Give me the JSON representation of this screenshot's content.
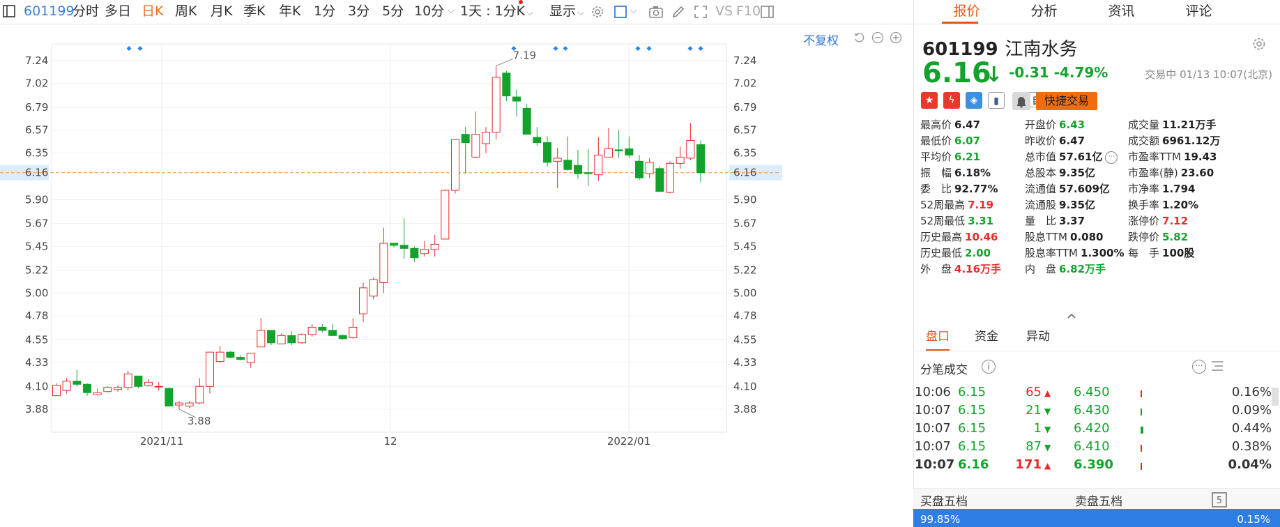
{
  "stock": {
    "code": "601199",
    "name": "江南水务",
    "price": "6.16",
    "change": "-0.31",
    "change_pct": "-4.79%",
    "trade_status": "交易中 01/13 10:07(北京)",
    "down_color": "#13a32c",
    "up_color": "#e8292a"
  },
  "toolbar": {
    "code": "601199",
    "items": [
      "分时",
      "多日",
      "日K",
      "周K",
      "月K",
      "季K",
      "年K",
      "1分",
      "3分",
      "5分",
      "10分"
    ],
    "active": "日K",
    "range": "1天 : 1分K",
    "display": "显示",
    "vs": "VS",
    "f10": "F10",
    "accent_color": "#f26b1d"
  },
  "chart": {
    "fq_label": "不复权",
    "ref_price": "6.16",
    "high_label": "7.19",
    "low_label": "3.88"
  },
  "chart_data": {
    "type": "candlestick",
    "y_ticks": [
      "7.24",
      "7.02",
      "6.79",
      "6.57",
      "6.35",
      "6.16",
      "5.90",
      "5.67",
      "5.45",
      "5.22",
      "5.00",
      "4.78",
      "4.55",
      "4.33",
      "4.10",
      "3.88"
    ],
    "x_ticks": [
      "2021/11",
      "12",
      "2022/01"
    ],
    "ylim": [
      3.88,
      7.24
    ],
    "candles": [
      {
        "o": 4.01,
        "h": 4.13,
        "l": 4.01,
        "c": 4.11
      },
      {
        "o": 4.06,
        "h": 4.18,
        "l": 4.03,
        "c": 4.15
      },
      {
        "o": 4.15,
        "h": 4.26,
        "l": 4.1,
        "c": 4.12
      },
      {
        "o": 4.12,
        "h": 4.13,
        "l": 4.01,
        "c": 4.04
      },
      {
        "o": 4.02,
        "h": 4.08,
        "l": 4.01,
        "c": 4.04
      },
      {
        "o": 4.05,
        "h": 4.1,
        "l": 4.04,
        "c": 4.09
      },
      {
        "o": 4.07,
        "h": 4.11,
        "l": 4.05,
        "c": 4.09
      },
      {
        "o": 4.09,
        "h": 4.25,
        "l": 4.06,
        "c": 4.22
      },
      {
        "o": 4.2,
        "h": 4.2,
        "l": 4.08,
        "c": 4.1
      },
      {
        "o": 4.11,
        "h": 4.17,
        "l": 4.1,
        "c": 4.14
      },
      {
        "o": 4.1,
        "h": 4.14,
        "l": 4.06,
        "c": 4.1
      },
      {
        "o": 4.08,
        "h": 4.09,
        "l": 3.91,
        "c": 3.91
      },
      {
        "o": 3.92,
        "h": 3.96,
        "l": 3.88,
        "c": 3.94
      },
      {
        "o": 3.91,
        "h": 3.96,
        "l": 3.89,
        "c": 3.94
      },
      {
        "o": 3.94,
        "h": 4.18,
        "l": 3.93,
        "c": 4.1
      },
      {
        "o": 4.1,
        "h": 4.43,
        "l": 4.03,
        "c": 4.43
      },
      {
        "o": 4.34,
        "h": 4.49,
        "l": 4.33,
        "c": 4.43
      },
      {
        "o": 4.43,
        "h": 4.44,
        "l": 4.37,
        "c": 4.38
      },
      {
        "o": 4.38,
        "h": 4.4,
        "l": 4.35,
        "c": 4.36
      },
      {
        "o": 4.33,
        "h": 4.42,
        "l": 4.28,
        "c": 4.42
      },
      {
        "o": 4.48,
        "h": 4.76,
        "l": 4.48,
        "c": 4.64
      },
      {
        "o": 4.64,
        "h": 4.64,
        "l": 4.5,
        "c": 4.52
      },
      {
        "o": 4.51,
        "h": 4.61,
        "l": 4.51,
        "c": 4.59
      },
      {
        "o": 4.59,
        "h": 4.63,
        "l": 4.5,
        "c": 4.52
      },
      {
        "o": 4.52,
        "h": 4.61,
        "l": 4.51,
        "c": 4.6
      },
      {
        "o": 4.6,
        "h": 4.7,
        "l": 4.58,
        "c": 4.67
      },
      {
        "o": 4.67,
        "h": 4.7,
        "l": 4.62,
        "c": 4.64
      },
      {
        "o": 4.64,
        "h": 4.7,
        "l": 4.6,
        "c": 4.59
      },
      {
        "o": 4.59,
        "h": 4.6,
        "l": 4.55,
        "c": 4.56
      },
      {
        "o": 4.57,
        "h": 4.76,
        "l": 4.56,
        "c": 4.67
      },
      {
        "o": 4.8,
        "h": 5.1,
        "l": 4.72,
        "c": 5.05
      },
      {
        "o": 4.97,
        "h": 5.15,
        "l": 4.94,
        "c": 5.13
      },
      {
        "o": 5.1,
        "h": 5.63,
        "l": 5.0,
        "c": 5.48
      },
      {
        "o": 5.48,
        "h": 5.48,
        "l": 5.44,
        "c": 5.46
      },
      {
        "o": 5.46,
        "h": 5.72,
        "l": 5.33,
        "c": 5.43
      },
      {
        "o": 5.43,
        "h": 5.45,
        "l": 5.3,
        "c": 5.34
      },
      {
        "o": 5.38,
        "h": 5.5,
        "l": 5.35,
        "c": 5.42
      },
      {
        "o": 5.42,
        "h": 5.56,
        "l": 5.35,
        "c": 5.47
      },
      {
        "o": 5.52,
        "h": 6.0,
        "l": 5.52,
        "c": 5.99
      },
      {
        "o": 5.99,
        "h": 6.48,
        "l": 5.96,
        "c": 6.48
      },
      {
        "o": 6.53,
        "h": 6.6,
        "l": 6.15,
        "c": 6.45
      },
      {
        "o": 6.31,
        "h": 6.75,
        "l": 6.3,
        "c": 6.53
      },
      {
        "o": 6.44,
        "h": 6.6,
        "l": 6.35,
        "c": 6.55
      },
      {
        "o": 6.55,
        "h": 7.19,
        "l": 6.48,
        "c": 7.08
      },
      {
        "o": 7.12,
        "h": 7.14,
        "l": 6.85,
        "c": 6.9
      },
      {
        "o": 6.89,
        "h": 6.96,
        "l": 6.7,
        "c": 6.85
      },
      {
        "o": 6.78,
        "h": 6.82,
        "l": 6.53,
        "c": 6.53
      },
      {
        "o": 6.5,
        "h": 6.6,
        "l": 6.42,
        "c": 6.45
      },
      {
        "o": 6.45,
        "h": 6.51,
        "l": 6.22,
        "c": 6.26
      },
      {
        "o": 6.27,
        "h": 6.4,
        "l": 6.01,
        "c": 6.3
      },
      {
        "o": 6.28,
        "h": 6.51,
        "l": 6.18,
        "c": 6.19
      },
      {
        "o": 6.23,
        "h": 6.38,
        "l": 6.1,
        "c": 6.15
      },
      {
        "o": 6.16,
        "h": 6.39,
        "l": 6.03,
        "c": 6.15
      },
      {
        "o": 6.14,
        "h": 6.5,
        "l": 6.08,
        "c": 6.33
      },
      {
        "o": 6.31,
        "h": 6.59,
        "l": 6.31,
        "c": 6.39
      },
      {
        "o": 6.38,
        "h": 6.57,
        "l": 6.3,
        "c": 6.37
      },
      {
        "o": 6.39,
        "h": 6.51,
        "l": 6.3,
        "c": 6.33
      },
      {
        "o": 6.27,
        "h": 6.33,
        "l": 6.09,
        "c": 6.11
      },
      {
        "o": 6.15,
        "h": 6.3,
        "l": 6.11,
        "c": 6.26
      },
      {
        "o": 6.2,
        "h": 6.22,
        "l": 5.98,
        "c": 5.98
      },
      {
        "o": 5.97,
        "h": 6.27,
        "l": 5.96,
        "c": 6.25
      },
      {
        "o": 6.25,
        "h": 6.41,
        "l": 6.2,
        "c": 6.31
      },
      {
        "o": 6.3,
        "h": 6.64,
        "l": 6.28,
        "c": 6.47
      },
      {
        "o": 6.43,
        "h": 6.47,
        "l": 6.07,
        "c": 6.16
      }
    ],
    "marker_x": [
      185,
      201,
      737,
      797,
      811,
      915,
      931,
      990,
      1005
    ]
  },
  "panel": {
    "tabs": [
      "报价",
      "分析",
      "资讯",
      "评论"
    ],
    "active_tab": "报价",
    "fav_label": "自选",
    "quick_trade": "快捷交易",
    "stats": [
      [
        {
          "k": "最高价",
          "v": "6.47",
          "c": "black"
        },
        {
          "k": "开盘价",
          "v": "6.43",
          "c": "green"
        },
        {
          "k": "成交量",
          "v": "11.21万手",
          "c": "black"
        }
      ],
      [
        {
          "k": "最低价",
          "v": "6.07",
          "c": "green"
        },
        {
          "k": "昨收价",
          "v": "6.47",
          "c": "black"
        },
        {
          "k": "成交额",
          "v": "6961.12万",
          "c": "black"
        }
      ],
      [
        {
          "k": "平均价",
          "v": "6.21",
          "c": "green"
        },
        {
          "k": "总市值",
          "v": "57.61亿",
          "c": "black"
        },
        {
          "k": "市盈率TTM",
          "v": "19.43",
          "c": "black"
        }
      ],
      [
        {
          "k": "振　幅",
          "v": "6.18%",
          "c": "black"
        },
        {
          "k": "总股本",
          "v": "9.35亿",
          "c": "black"
        },
        {
          "k": "市盈率(静)",
          "v": "23.60",
          "c": "black"
        }
      ],
      [
        {
          "k": "委　比",
          "v": "92.77%",
          "c": "black"
        },
        {
          "k": "流通值",
          "v": "57.609亿",
          "c": "black"
        },
        {
          "k": "市净率",
          "v": "1.794",
          "c": "black"
        }
      ],
      [
        {
          "k": "52周最高",
          "v": "7.19",
          "c": "red"
        },
        {
          "k": "流通股",
          "v": "9.35亿",
          "c": "black"
        },
        {
          "k": "换手率",
          "v": "1.20%",
          "c": "black"
        }
      ],
      [
        {
          "k": "52周最低",
          "v": "3.31",
          "c": "green"
        },
        {
          "k": "量　比",
          "v": "3.37",
          "c": "black"
        },
        {
          "k": "涨停价",
          "v": "7.12",
          "c": "red"
        }
      ],
      [
        {
          "k": "历史最高",
          "v": "10.46",
          "c": "red"
        },
        {
          "k": "股息TTM",
          "v": "0.080",
          "c": "black"
        },
        {
          "k": "跌停价",
          "v": "5.82",
          "c": "green"
        }
      ],
      [
        {
          "k": "历史最低",
          "v": "2.00",
          "c": "green"
        },
        {
          "k": "股息率TTM",
          "v": "1.300%",
          "c": "black"
        },
        {
          "k": "每　手",
          "v": "100股",
          "c": "black"
        }
      ],
      [
        {
          "k": "外　盘",
          "v": "4.16万手",
          "c": "red"
        },
        {
          "k": "内　盘",
          "v": "6.82万手",
          "c": "green"
        }
      ]
    ],
    "subtabs": [
      "盘口",
      "资金",
      "异动"
    ],
    "active_subtab": "盘口",
    "ticks_title": "分笔成交",
    "ticks": [
      {
        "time": "10:06",
        "price": "6.15",
        "vol": "65",
        "dir": "up",
        "level": "6.450",
        "pct": "0.16%"
      },
      {
        "time": "10:07",
        "price": "6.15",
        "vol": "21",
        "dir": "down",
        "level": "6.430",
        "pct": "0.09%"
      },
      {
        "time": "10:07",
        "price": "6.15",
        "vol": "1",
        "dir": "down",
        "level": "6.420",
        "pct": "0.44%"
      },
      {
        "time": "10:07",
        "price": "6.15",
        "vol": "87",
        "dir": "down",
        "level": "6.410",
        "pct": "0.38%"
      },
      {
        "time": "10:07",
        "price": "6.16",
        "vol": "171",
        "dir": "up",
        "level": "6.390",
        "pct": "0.04%"
      }
    ],
    "buy5": "买盘五档",
    "sell5": "卖盘五档",
    "buy_pct": "99.85%",
    "sell_pct": "0.15%"
  }
}
